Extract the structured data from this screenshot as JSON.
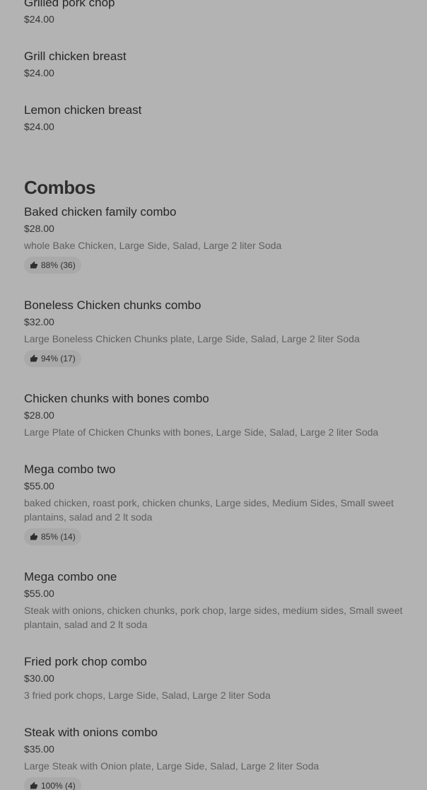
{
  "menu": {
    "grill_items": [
      {
        "name": "Grilled pork chop",
        "price": "$24.00"
      },
      {
        "name": "Grill chicken breast",
        "price": "$24.00"
      },
      {
        "name": "Lemon chicken breast",
        "price": "$24.00"
      }
    ],
    "combos": {
      "title": "Combos",
      "items": [
        {
          "name": "Baked chicken family combo",
          "price": "$28.00",
          "description": "whole Bake Chicken, Large Side, Salad, Large 2 liter Soda",
          "rating": "88% (36)"
        },
        {
          "name": "Boneless Chicken chunks combo",
          "price": "$32.00",
          "description": "Large Boneless Chicken Chunks plate, Large Side, Salad, Large 2 liter Soda",
          "rating": "94% (17)"
        },
        {
          "name": "Chicken chunks with bones combo",
          "price": "$28.00",
          "description": "Large Plate of Chicken Chunks with bones, Large Side, Salad, Large 2 liter Soda"
        },
        {
          "name": "Mega combo two",
          "price": "$55.00",
          "description": "baked chicken, roast pork, chicken chunks, Large sides, Medium Sides, Small sweet plantains, salad and 2 lt soda",
          "rating": "85% (14)"
        },
        {
          "name": "Mega combo one",
          "price": "$55.00",
          "description": "Steak with onions, chicken chunks, pork chop, large sides, medium sides, Small sweet plantain, salad and 2 lt soda"
        },
        {
          "name": "Fried pork chop combo",
          "price": "$30.00",
          "description": "3 fried pork chops, Large Side, Salad, Large 2 liter Soda"
        },
        {
          "name": "Steak with onions combo",
          "price": "$35.00",
          "description": "Large Steak with Onion plate, Large Side, Salad, Large 2 liter Soda",
          "rating": "100% (4)"
        }
      ]
    }
  },
  "icons": {
    "thumb": "thumbs-up-icon"
  },
  "colors": {
    "background": "#b3b3b3",
    "badge": "#a9a9a9",
    "text": "#262626",
    "muted": "#5f5f5f"
  }
}
